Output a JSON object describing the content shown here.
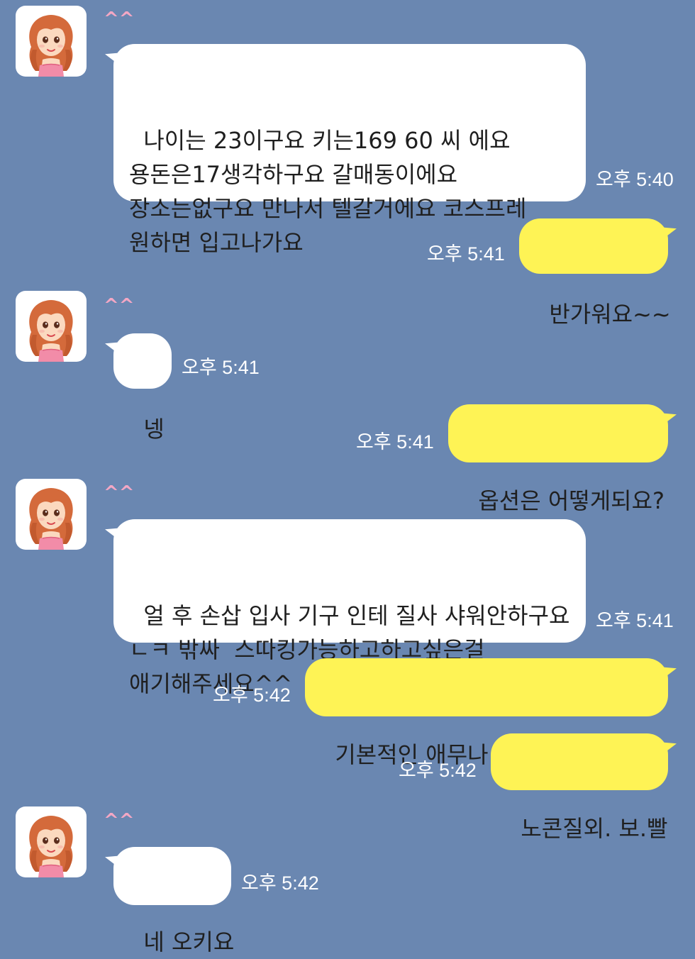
{
  "theme": {
    "background": "#6a87b1",
    "incoming_bubble": "#ffffff",
    "outgoing_bubble": "#fef355",
    "sender_name_color": "#f3a7c4"
  },
  "sender": {
    "name": "^^",
    "avatar_icon": "girl-avatar-icon"
  },
  "messages": [
    {
      "direction": "incoming",
      "show_sender": true,
      "text": "나이는 23이구요 키는169 60 씨 에요\n용돈은17생각하구요 갈매동이에요\n장소는없구요 만나서 텔갈거에요 코스프레\n원하면 입고나가요",
      "time": "오후 5:40"
    },
    {
      "direction": "outgoing",
      "text": "반가워요~~",
      "time": "오후 5:41"
    },
    {
      "direction": "incoming",
      "show_sender": true,
      "text": "넹",
      "time": "오후 5:41"
    },
    {
      "direction": "outgoing",
      "text": "옵션은 어떻게되요?",
      "time": "오후 5:41"
    },
    {
      "direction": "incoming",
      "show_sender": true,
      "text": "얼 후 손삽 입사 기구 인테 질사 샤워안하구요\nㄴㅋ 밖싸  스따킹가능하고하고싶은걸\n애기해주세요^^",
      "time": "오후 5:41"
    },
    {
      "direction": "outgoing",
      "text": "기본적인 애무나 스킨쉽은 다되죠?",
      "time": "오후 5:42"
    },
    {
      "direction": "outgoing",
      "text": "노콘질외. 보.빨",
      "time": "오후 5:42"
    },
    {
      "direction": "incoming",
      "show_sender": true,
      "text": "네 오키요",
      "time": "오후 5:42"
    }
  ]
}
